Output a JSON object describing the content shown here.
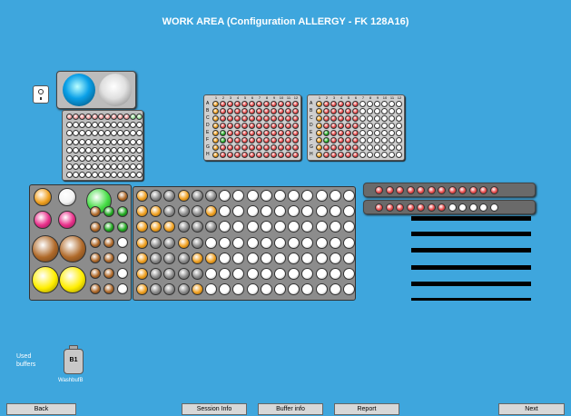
{
  "header": {
    "title": "WORK AREA (Configuration ALLERGY - FK 128A16)"
  },
  "footer": {
    "back_label": "Back",
    "session_label": "Session Info",
    "buffer_label": "Buffer info",
    "report_label": "Report",
    "next_label": "Next"
  },
  "used_buffers": {
    "label_line1": "Used",
    "label_line2": "buffers",
    "bottle_code": "B1",
    "bottle_name": "WashbufB"
  },
  "plate_left": {
    "row_letters": [
      "A",
      "B",
      "C",
      "D",
      "E",
      "F",
      "G",
      "H"
    ],
    "col_numbers": [
      "1",
      "2",
      "3",
      "4",
      "5",
      "6",
      "7",
      "8",
      "9",
      "10",
      "11",
      "12"
    ]
  },
  "plate_right": {
    "row_letters": [
      "A",
      "B",
      "C",
      "D",
      "E",
      "F",
      "G",
      "H"
    ],
    "col_numbers": [
      "1",
      "2",
      "3",
      "4",
      "5",
      "6",
      "7",
      "8",
      "9",
      "10",
      "11",
      "12"
    ]
  },
  "colors": {
    "background": "#3ea6dd",
    "well_red": "#e84a4a",
    "well_orange": "#f0a020",
    "well_green": "#22aa22",
    "well_empty": "#ffffff",
    "tube_brown": "#b06a2a",
    "tube_magenta": "#e8308a",
    "tube_yellow": "#ffee00"
  },
  "icons": [
    "power-switch-icon",
    "bottle-icon"
  ]
}
